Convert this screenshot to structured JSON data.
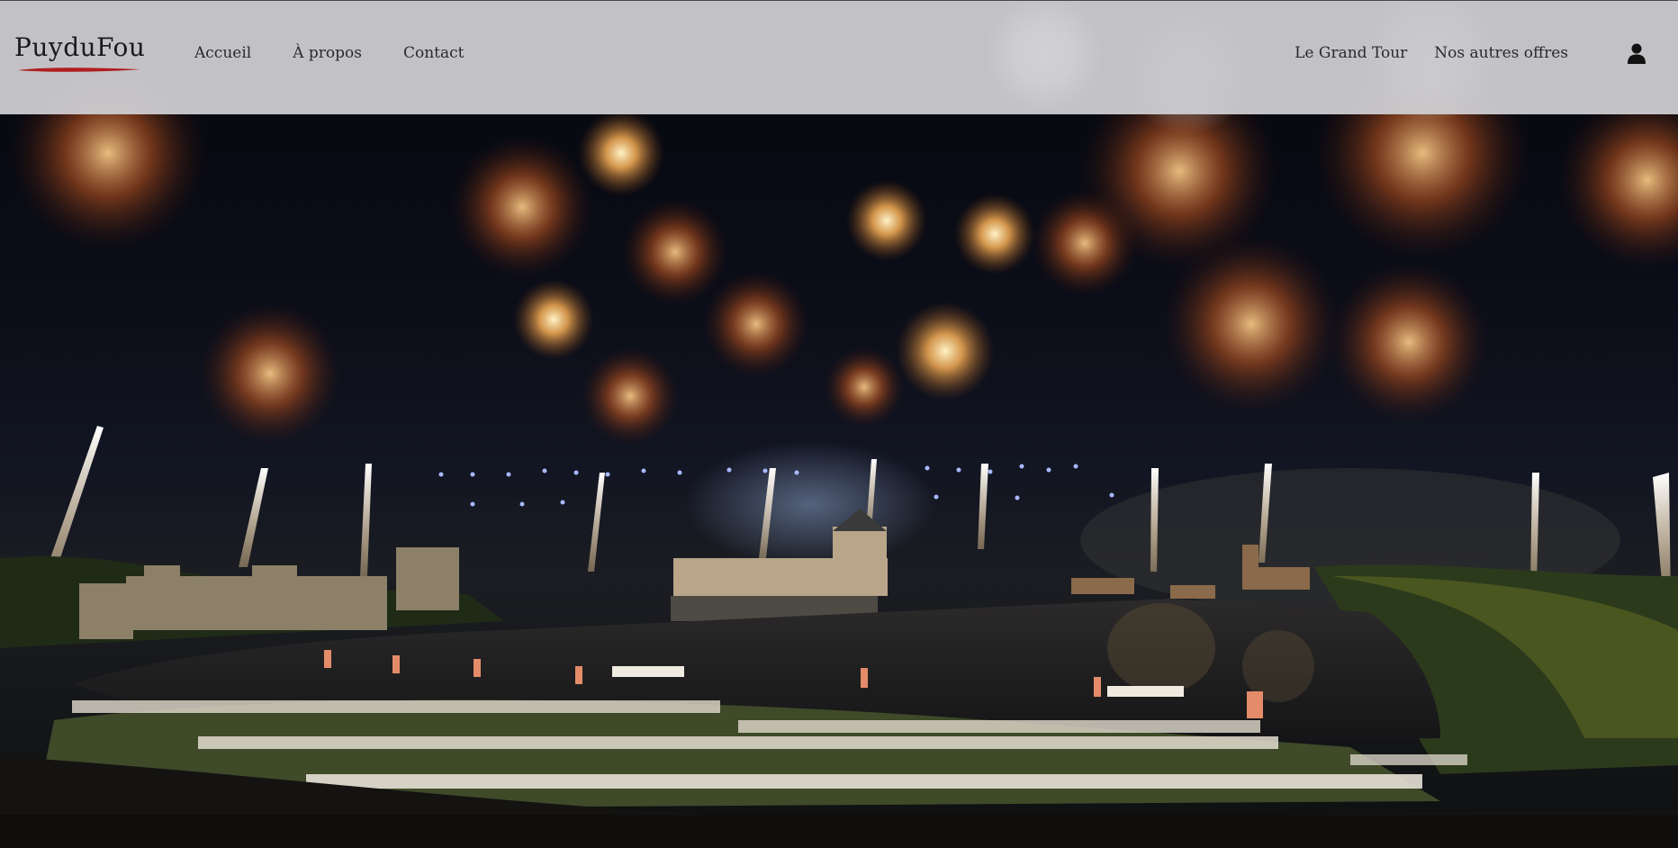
{
  "header": {
    "logo_text": "PuyduFou",
    "nav_left": [
      {
        "label": "Accueil"
      },
      {
        "label": "À propos"
      },
      {
        "label": "Contact"
      }
    ],
    "nav_right": [
      {
        "label": "Le Grand Tour"
      },
      {
        "label": "Nos autres offres"
      }
    ],
    "user_icon": "user-icon"
  },
  "hero": {
    "image": "night fireworks show over lake, castle and performers"
  },
  "colors": {
    "header_bg": "#cecfd2",
    "logo_red": "#b01e1e",
    "text": "#2a2a2a"
  }
}
